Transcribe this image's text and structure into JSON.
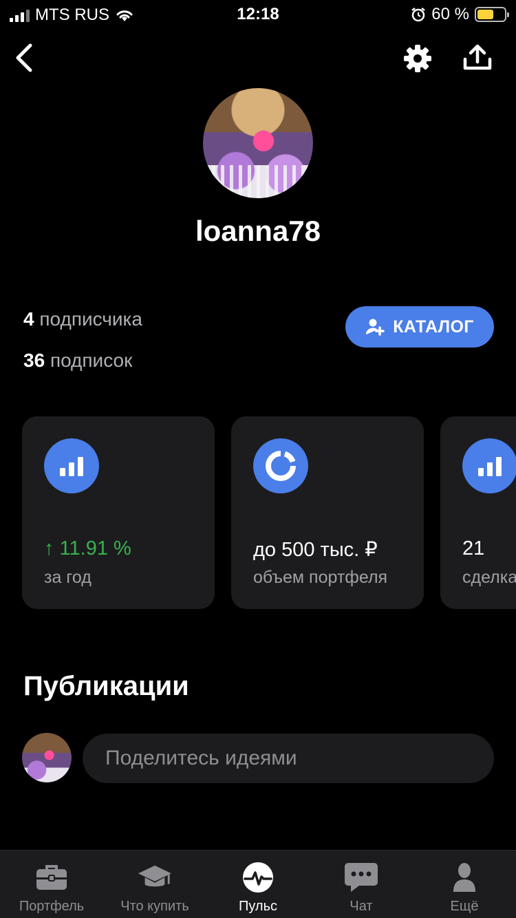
{
  "status_bar": {
    "carrier": "MTS RUS",
    "time": "12:18",
    "battery_percent": "60 %",
    "battery_level": 0.6
  },
  "nav": {
    "back_icon": "chevron-left-icon",
    "settings_icon": "gear-icon",
    "share_icon": "share-icon"
  },
  "profile": {
    "username": "loanna78",
    "followers_count": "4",
    "followers_label": "подписчика",
    "following_count": "36",
    "following_label": "подписок",
    "catalog_button": "КАТАЛОГ"
  },
  "cards": [
    {
      "icon": "bar-chart-icon",
      "value": "↑ 11.91 %",
      "label": "за год",
      "value_color": "#37b24d"
    },
    {
      "icon": "donut-icon",
      "value": "до 500 тыс. ₽",
      "label": "объем портфеля"
    },
    {
      "icon": "bar-chart-icon",
      "value": "21",
      "label": "сделка"
    }
  ],
  "publications": {
    "title": "Публикации",
    "input_placeholder": "Поделитесь идеями"
  },
  "tabbar": [
    {
      "label": "Портфель",
      "icon": "briefcase-icon",
      "active": false
    },
    {
      "label": "Что купить",
      "icon": "graduation-cap-icon",
      "active": false
    },
    {
      "label": "Пульс",
      "icon": "pulse-icon",
      "active": true
    },
    {
      "label": "Чат",
      "icon": "chat-icon",
      "active": false
    },
    {
      "label": "Ещё",
      "icon": "person-icon",
      "active": false
    }
  ],
  "colors": {
    "accent": "#4a7ee8",
    "positive": "#37b24d",
    "card_bg": "#1c1c1e",
    "background": "#000000"
  }
}
